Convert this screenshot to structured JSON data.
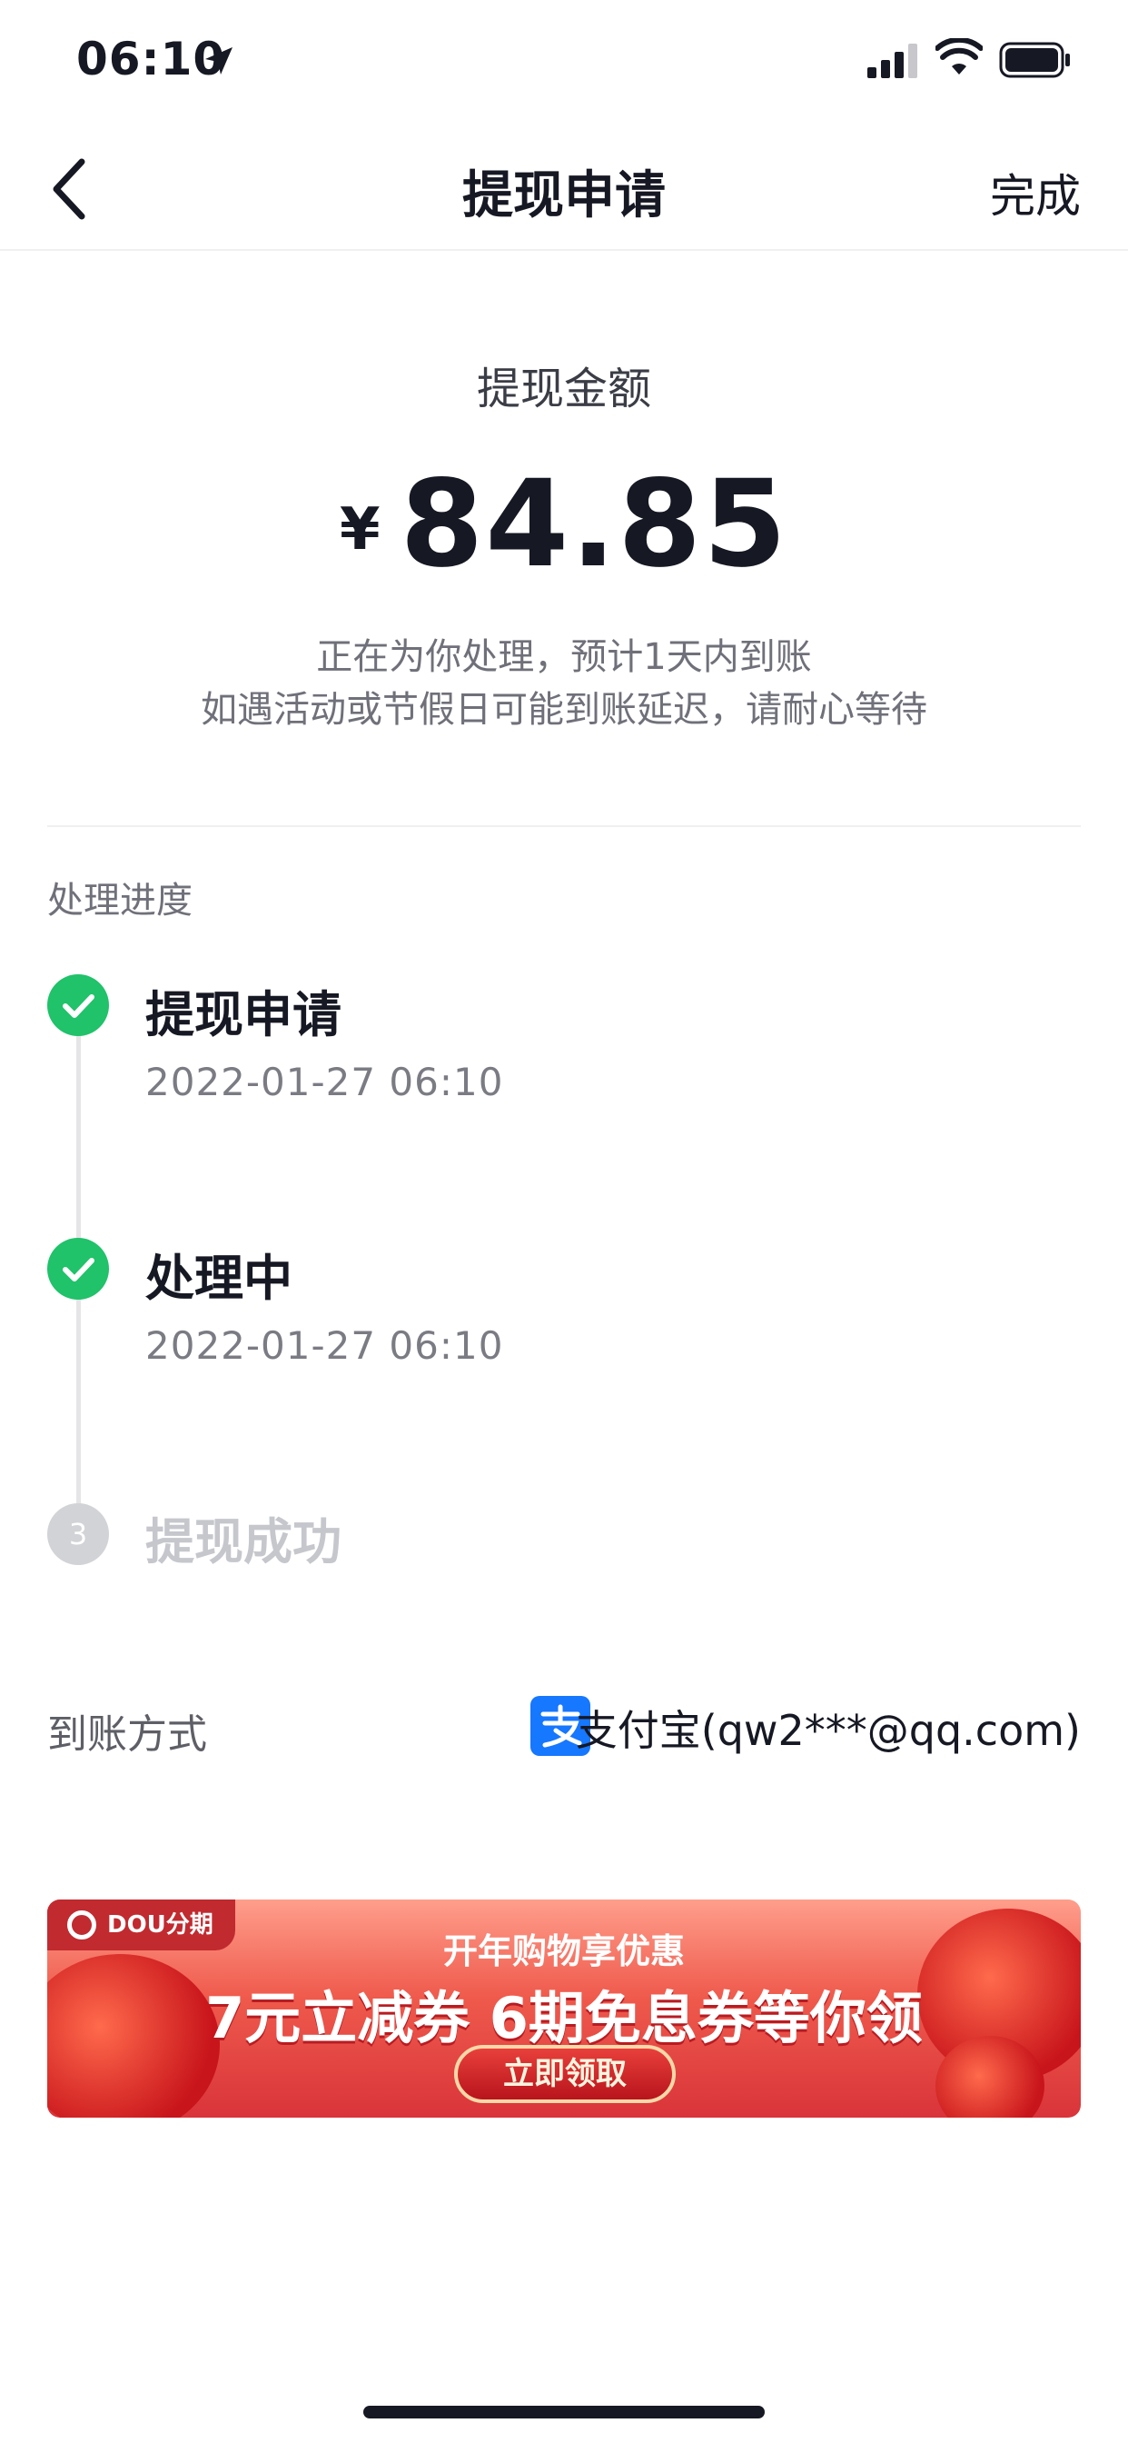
{
  "status_bar": {
    "time": "06:10",
    "icons": [
      "location-arrow-icon",
      "signal-icon",
      "wifi-icon",
      "battery-icon"
    ]
  },
  "nav": {
    "title": "提现申请",
    "done_label": "完成",
    "back_icon": "chevron-left-icon"
  },
  "amount": {
    "label": "提现金额",
    "currency": "¥",
    "value": "84.85",
    "note_line1": "正在为你处理，预计1天内到账",
    "note_line2": "如遇活动或节假日可能到账延迟，请耐心等待"
  },
  "progress": {
    "title": "处理进度",
    "steps": [
      {
        "title": "提现申请",
        "time": "2022-01-27 06:10",
        "status": "done"
      },
      {
        "title": "处理中",
        "time": "2022-01-27 06:10",
        "status": "done"
      },
      {
        "title": "提现成功",
        "number": "3",
        "status": "pending"
      }
    ]
  },
  "method": {
    "label": "到账方式",
    "value": "支付宝(qw2***@qq.com)",
    "icon": "alipay-icon"
  },
  "banner": {
    "brand": "DOU分期",
    "headline": "开年购物享优惠",
    "main": "7元立减券 6期免息券等你领",
    "button": "立即领取"
  },
  "colors": {
    "success": "#20c26a",
    "pending": "#d2d3d7",
    "text_primary": "#161823",
    "alipay": "#1677ff"
  }
}
